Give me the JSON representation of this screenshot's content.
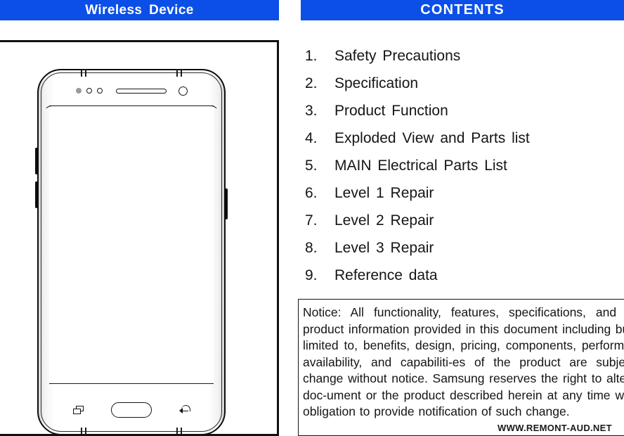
{
  "headers": {
    "left_title": "Wireless  Device",
    "right_title": "CONTENTS"
  },
  "colors": {
    "header_blue": "#0b4fe8",
    "header_text": "#ffffff",
    "body_text": "#151515",
    "line_art": "#141414"
  },
  "device": {
    "caption": "wireless-device-front-view",
    "parts": {
      "proximity_sensor": "proximity-sensor",
      "iris_sensor": "iris-sensor",
      "light_sensor": "light-sensor",
      "earpiece": "earpiece-speaker",
      "front_camera": "front-camera",
      "volume_up": "volume-up-key",
      "volume_down": "volume-down-key",
      "power_key": "power-key",
      "recents_key": "recents-key",
      "home_key": "home-key",
      "back_key": "back-key",
      "display": "display-screen"
    }
  },
  "contents": {
    "items": [
      {
        "num": "1.",
        "label": "Safety  Precautions"
      },
      {
        "num": "2.",
        "label": "Specification"
      },
      {
        "num": "3.",
        "label": "Product  Function"
      },
      {
        "num": "4.",
        "label": "Exploded  View  and  Parts  list"
      },
      {
        "num": "5.",
        "label": "MAIN  Electrical  Parts  List"
      },
      {
        "num": "6.",
        "label": "Level  1  Repair"
      },
      {
        "num": "7.",
        "label": "Level  2  Repair"
      },
      {
        "num": "8.",
        "label": "Level  3  Repair"
      },
      {
        "num": "9.",
        "label": "Reference  data"
      }
    ]
  },
  "notice": {
    "text": "Notice: All functionality, features, specifications, and other product information provided in this document including but not limited to, benefits, design, pricing, components, performance, availability, and capabiliti-es of the product are subject to change without notice. Samsung reserves the right to alter this doc-ument or the product described herein at any time without obligation to provide notification of such change."
  },
  "watermark": {
    "text": "WWW.REMONT-AUD.NET"
  }
}
